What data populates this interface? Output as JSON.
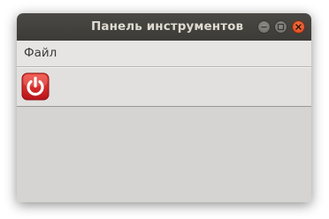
{
  "window": {
    "title": "Панель инструментов",
    "colors": {
      "titlebar": "#3c3b37",
      "close_button": "#e95420",
      "body": "#d5d4d2"
    }
  },
  "menubar": {
    "items": [
      {
        "label": "Файл"
      }
    ]
  },
  "toolbar": {
    "buttons": [
      {
        "icon": "power-icon",
        "color": "#d22222"
      }
    ]
  }
}
